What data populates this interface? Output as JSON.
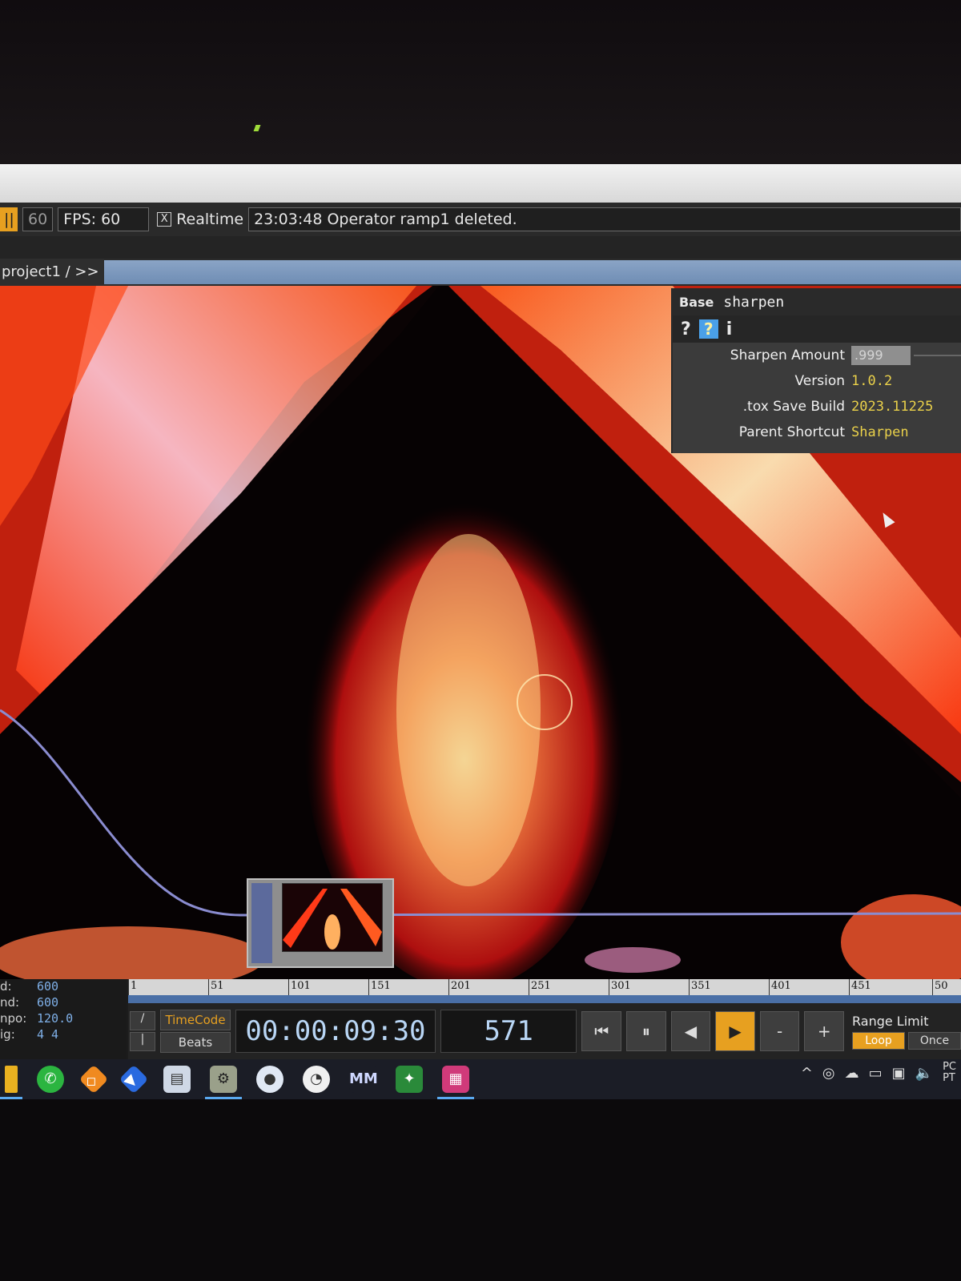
{
  "status_bar": {
    "frame_rate_value": "60",
    "fps_label": "FPS:",
    "fps_value": "60",
    "realtime_check": "X",
    "realtime_label": "Realtime",
    "message": "23:03:48 Operator ramp1 deleted."
  },
  "path_bar": {
    "path": "project1 / >>"
  },
  "parameters": {
    "op_type": "Base",
    "op_name": "sharpen",
    "icons": [
      "?",
      "?",
      "i"
    ],
    "rows": [
      {
        "label": "Sharpen Amount",
        "value": ".999"
      },
      {
        "label": "Version",
        "value": "1.0.2"
      },
      {
        "label": ".tox Save Build",
        "value": "2023.11225"
      },
      {
        "label": "Parent Shortcut",
        "value": "Sharpen"
      }
    ]
  },
  "timeline": {
    "ticks": [
      "1",
      "51",
      "101",
      "151",
      "201",
      "251",
      "301",
      "351",
      "401",
      "451",
      "50"
    ],
    "left_info": [
      {
        "label": "d:",
        "value": "600"
      },
      {
        "label": "nd:",
        "value": "600"
      },
      {
        "label": "npo:",
        "value": "120.0"
      },
      {
        "label": "ig:",
        "value": "4    4"
      }
    ],
    "mode_timecode": "TimeCode",
    "mode_beats": "Beats",
    "timecode": "00:00:09:30",
    "frame": "571",
    "range_label": "Range Limit",
    "range_loop": "Loop",
    "range_once": "Once"
  },
  "taskbar": {
    "icons": [
      "folder-icon",
      "whatsapp-icon",
      "sketch-icon",
      "video-icon",
      "files-icon",
      "touchdesigner-icon",
      "chat-icon",
      "speedometer-icon",
      "mm-icon",
      "game-icon",
      "grid-app-icon"
    ],
    "tray": [
      "^",
      "PC",
      "PT"
    ]
  },
  "colors": {
    "accent": "#e7a020",
    "value_yellow": "#e9d04a",
    "timecode_blue": "#b9d6f5"
  }
}
